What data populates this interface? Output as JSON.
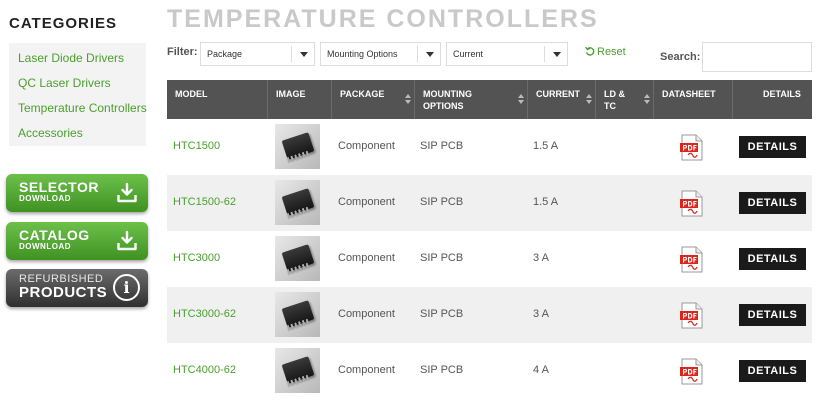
{
  "sidebar": {
    "title": "CATEGORIES",
    "items": [
      {
        "label": "Laser Diode Drivers"
      },
      {
        "label": "QC Laser Drivers"
      },
      {
        "label": "Temperature Controllers"
      },
      {
        "label": "Accessories"
      }
    ],
    "selector_button": {
      "line1": "SELECTOR",
      "line2": "DOWNLOAD",
      "icon": "download-icon"
    },
    "catalog_button": {
      "line1": "CATALOG",
      "line2": "DOWNLOAD",
      "icon": "download-icon"
    },
    "refurbished_button": {
      "line1": "REFURBISHED",
      "line2": "PRODUCTS",
      "icon": "info-icon"
    }
  },
  "page_title": "TEMPERATURE CONTROLLERS",
  "filters": {
    "label": "Filter:",
    "selects": [
      {
        "value": "Package"
      },
      {
        "value": "Mounting Options"
      },
      {
        "value": "Current"
      }
    ],
    "reset_label": "Reset",
    "search_label": "Search:",
    "search_value": ""
  },
  "table": {
    "headers": [
      {
        "label": "MODEL"
      },
      {
        "label": "IMAGE"
      },
      {
        "label": "PACKAGE"
      },
      {
        "label": "MOUNTING OPTIONS"
      },
      {
        "label": "CURRENT"
      },
      {
        "label": "LD & TC"
      },
      {
        "label": "DATASHEET"
      },
      {
        "label": "DETAILS"
      }
    ],
    "rows": [
      {
        "model": "HTC1500",
        "package": "Component",
        "mounting": "SIP PCB",
        "current": "1.5 A",
        "details": "DETAILS"
      },
      {
        "model": "HTC1500-62",
        "package": "Component",
        "mounting": "SIP PCB",
        "current": "1.5 A",
        "details": "DETAILS"
      },
      {
        "model": "HTC3000",
        "package": "Component",
        "mounting": "SIP PCB",
        "current": "3 A",
        "details": "DETAILS"
      },
      {
        "model": "HTC3000-62",
        "package": "Component",
        "mounting": "SIP PCB",
        "current": "3 A",
        "details": "DETAILS"
      },
      {
        "model": "HTC4000-62",
        "package": "Component",
        "mounting": "SIP PCB",
        "current": "4 A",
        "details": "DETAILS"
      }
    ]
  },
  "colors": {
    "accent_green": "#4aa02c",
    "header_bg": "#535353",
    "details_bg": "#1a1a1a",
    "pdf_red": "#d9251c"
  }
}
